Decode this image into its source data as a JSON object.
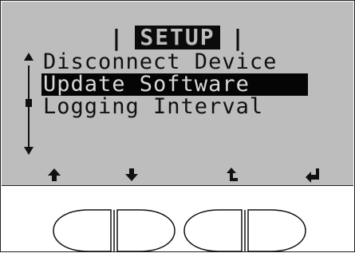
{
  "screen": {
    "title": "SETUP",
    "title_separator": "|"
  },
  "menu": {
    "items": [
      {
        "label": "Disconnect Device",
        "selected": false
      },
      {
        "label": "Update Software",
        "selected": true
      },
      {
        "label": "Logging Interval",
        "selected": false
      }
    ]
  },
  "softkeys": [
    {
      "icon": "arrow-up-icon"
    },
    {
      "icon": "arrow-down-icon"
    },
    {
      "icon": "back-arrow-icon"
    },
    {
      "icon": "enter-icon"
    }
  ],
  "colors": {
    "lcd_background": "#bdbdbd",
    "text": "#111111",
    "highlight": "#050505"
  }
}
